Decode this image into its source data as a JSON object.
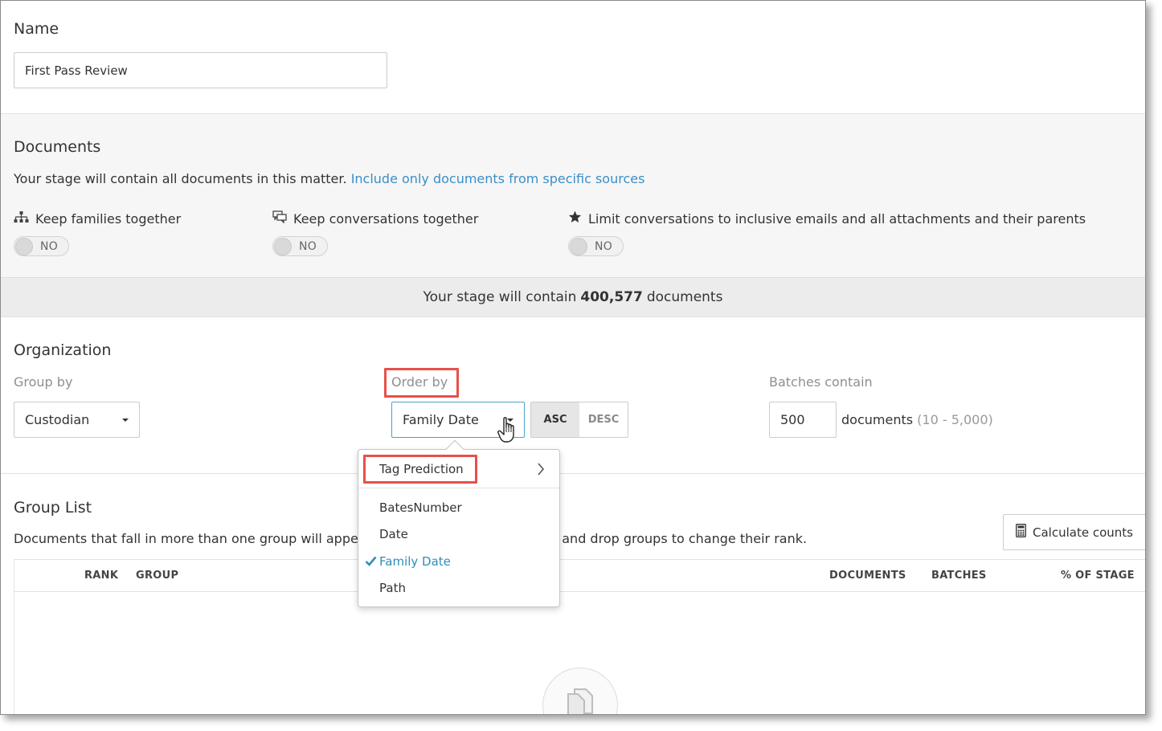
{
  "name_section": {
    "title": "Name",
    "value": "First Pass Review"
  },
  "documents": {
    "title": "Documents",
    "description": "Your stage will contain all documents in this matter.",
    "link": "Include only documents from specific sources",
    "options": [
      {
        "icon": "hierarchy-icon",
        "label": "Keep families together",
        "toggle": "NO"
      },
      {
        "icon": "conversation-icon",
        "label": "Keep conversations together",
        "toggle": "NO"
      },
      {
        "icon": "star-icon",
        "label": "Limit conversations to inclusive emails and all attachments and their parents",
        "toggle": "NO"
      }
    ],
    "count_prefix": "Your stage will contain",
    "count_value": "400,577",
    "count_suffix": "documents"
  },
  "organization": {
    "title": "Organization",
    "group_by_label": "Group by",
    "group_by_value": "Custodian",
    "order_by_label": "Order by",
    "order_by_value": "Family Date",
    "sort_asc": "ASC",
    "sort_desc": "DESC",
    "sort_selected": "ASC",
    "batches_label": "Batches contain",
    "batches_value": "500",
    "batches_unit": "documents",
    "batches_range": "(10 - 5,000)"
  },
  "order_menu": {
    "submenu": "Tag Prediction",
    "items": [
      "BatesNumber",
      "Date",
      "Family Date",
      "Path"
    ],
    "selected": "Family Date"
  },
  "group_list": {
    "title": "Group List",
    "description_left": "Documents that fall in more than one group will appear i",
    "description_right": "g and drop groups to change their rank.",
    "calculate_button": "Calculate counts",
    "columns": {
      "rank": "RANK",
      "group": "GROUP",
      "documents": "DOCUMENTS",
      "batches": "BATCHES",
      "percent": "% OF STAGE"
    }
  },
  "colors": {
    "accent": "#3a8fc7",
    "highlight": "#e8504a",
    "selected_item": "#2f8fb5"
  }
}
